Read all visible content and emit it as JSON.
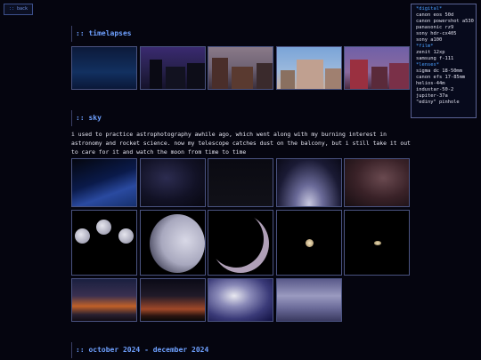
{
  "nav": {
    "back_prefix": "::",
    "back_label": "back"
  },
  "sections": {
    "timelapses": {
      "title": ":: timelapses"
    },
    "sky": {
      "title": ":: sky",
      "description": "i used to practice astrophotography awhile ago, which went along with my burning interest in astronomy and rocket science. now my telescope catches dust on the balcony, but i still take it out to care for it and watch the moon from time to time"
    },
    "period": {
      "title": ":: october 2024 - december 2024"
    }
  },
  "gear": {
    "digital_head": "*digital*",
    "digital": [
      "canon eos 50d",
      "canon powershot a530",
      "panasonic rz9",
      "sony hdr-cx405",
      "sony a100"
    ],
    "film_head": "*film*",
    "film": [
      "zenit 12xp",
      "samsung f-111"
    ],
    "lenses_head": "*lenses*",
    "lenses": [
      "sigma dc 18-50mm",
      "canon efs 17-85mm",
      "helios-44m",
      "industar-50-2",
      "jupiter-37a",
      "\"ediny\" pinhole"
    ]
  },
  "colors": {
    "background": "#05050f",
    "accent": "#6ea0ff",
    "heading_accent": "#4aa0ff",
    "border": "#4a5380"
  }
}
